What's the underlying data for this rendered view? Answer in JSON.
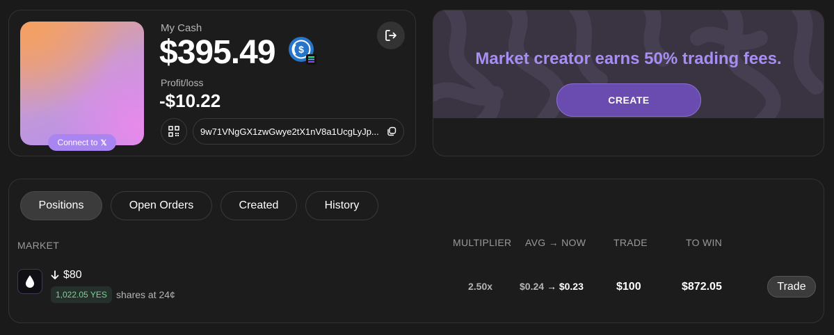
{
  "wallet": {
    "connect_label": "Connect to",
    "connect_icon": "x-logo-icon",
    "cash_label": "My Cash",
    "cash_value": "$395.49",
    "cash_token_icon": "usdc-solana-icon",
    "profit_loss_label": "Profit/loss",
    "profit_loss_value": "-$10.22",
    "address": "9w71VNgGX1zwGwye2tX1nV8a1UcgLyJp...",
    "logout_icon": "logout-icon",
    "qr_icon": "qr-code-icon",
    "copy_icon": "copy-icon"
  },
  "promo": {
    "title": "Market creator earns 50% trading fees.",
    "create_label": "CREATE"
  },
  "tabs": [
    {
      "label": "Positions",
      "active": true
    },
    {
      "label": "Open Orders",
      "active": false
    },
    {
      "label": "Created",
      "active": false
    },
    {
      "label": "History",
      "active": false
    }
  ],
  "table": {
    "columns": {
      "market": "MARKET",
      "multiplier": "MULTIPLIER",
      "avg_now": "AVG → NOW",
      "trade": "TRADE",
      "to_win": "TO WIN"
    },
    "rows": [
      {
        "market_icon": "water-drop-icon",
        "direction_icon": "arrow-down-icon",
        "title": "$80",
        "badge": "1,022.05 YES",
        "shares_text": "shares at 24¢",
        "multiplier": "2.50x",
        "avg": "$0.24",
        "now": "$0.23",
        "arrow": "→",
        "trade": "$100",
        "to_win": "$872.05",
        "action_label": "Trade"
      }
    ]
  },
  "colors": {
    "background": "#1a1a1a",
    "accent_purple": "#a88df5",
    "create_button": "#6a4cb0",
    "yes_green": "#7ed29a"
  }
}
